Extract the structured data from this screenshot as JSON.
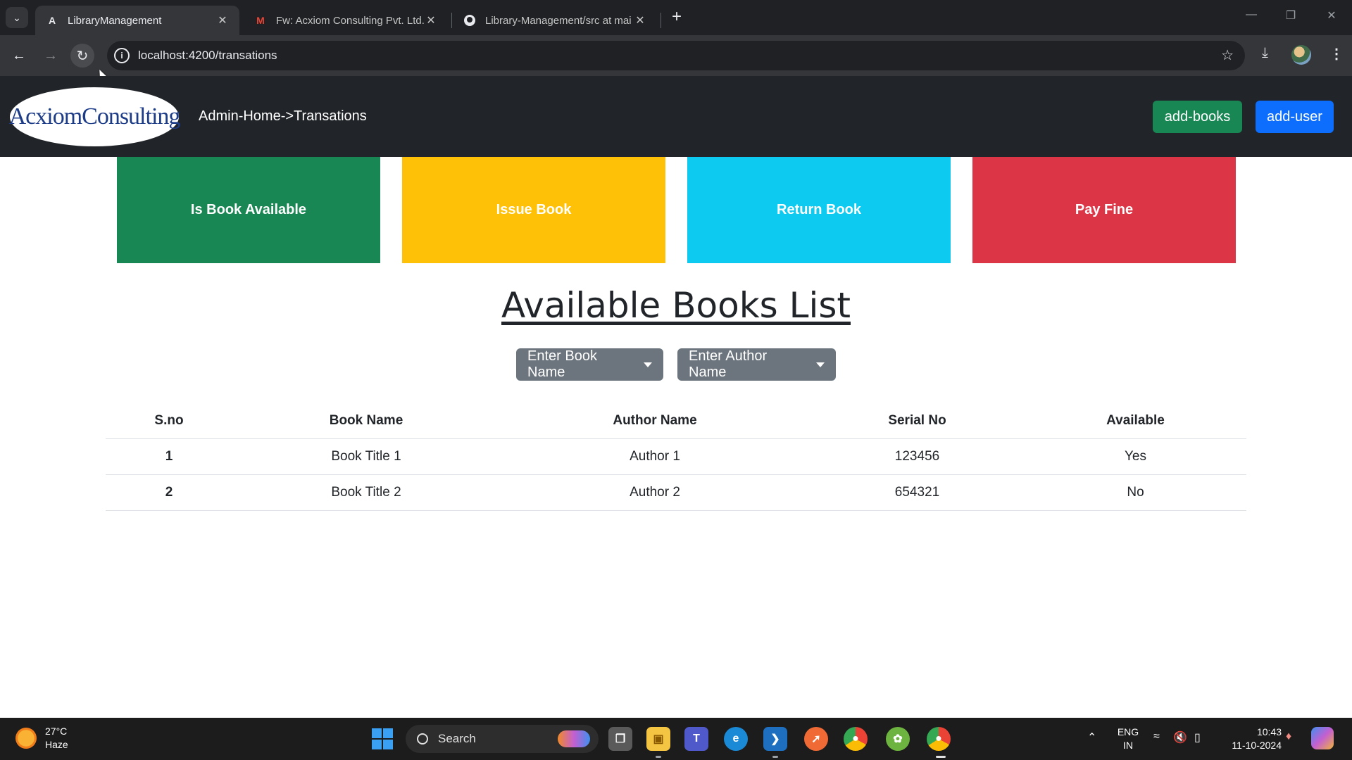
{
  "browser": {
    "tabs": [
      {
        "title": "LibraryManagement",
        "icon": "angular-icon"
      },
      {
        "title": "Fw: Acxiom Consulting Pvt. Ltd.",
        "icon": "gmail-icon"
      },
      {
        "title": "Library-Management/src at mai",
        "icon": "github-icon"
      }
    ],
    "url": "localhost:4200/transations"
  },
  "navbar": {
    "logo_text": "AcxiomConsulting",
    "breadcrumb": "Admin-Home->Transations",
    "add_books_label": "add-books",
    "add_user_label": "add-user"
  },
  "actions": {
    "available": "Is Book Available",
    "issue": "Issue Book",
    "return": "Return Book",
    "fine": "Pay Fine"
  },
  "heading": "Available Books List",
  "filters": {
    "book_name": "Enter Book Name",
    "author_name": "Enter Author Name"
  },
  "table": {
    "headers": [
      "S.no",
      "Book Name",
      "Author Name",
      "Serial No",
      "Available"
    ],
    "rows": [
      [
        "1",
        "Book Title 1",
        "Author 1",
        "123456",
        "Yes"
      ],
      [
        "2",
        "Book Title 2",
        "Author 2",
        "654321",
        "No"
      ]
    ]
  },
  "taskbar": {
    "temperature": "27°C",
    "weather": "Haze",
    "search_label": "Search",
    "language": "ENG",
    "region": "IN",
    "time": "10:43",
    "date": "11-10-2024"
  },
  "colors": {
    "success": "#198754",
    "warning": "#ffc107",
    "info": "#0dcaf0",
    "danger": "#dc3545",
    "primary": "#0d6efd",
    "secondary": "#6c757d",
    "dark": "#212529"
  }
}
